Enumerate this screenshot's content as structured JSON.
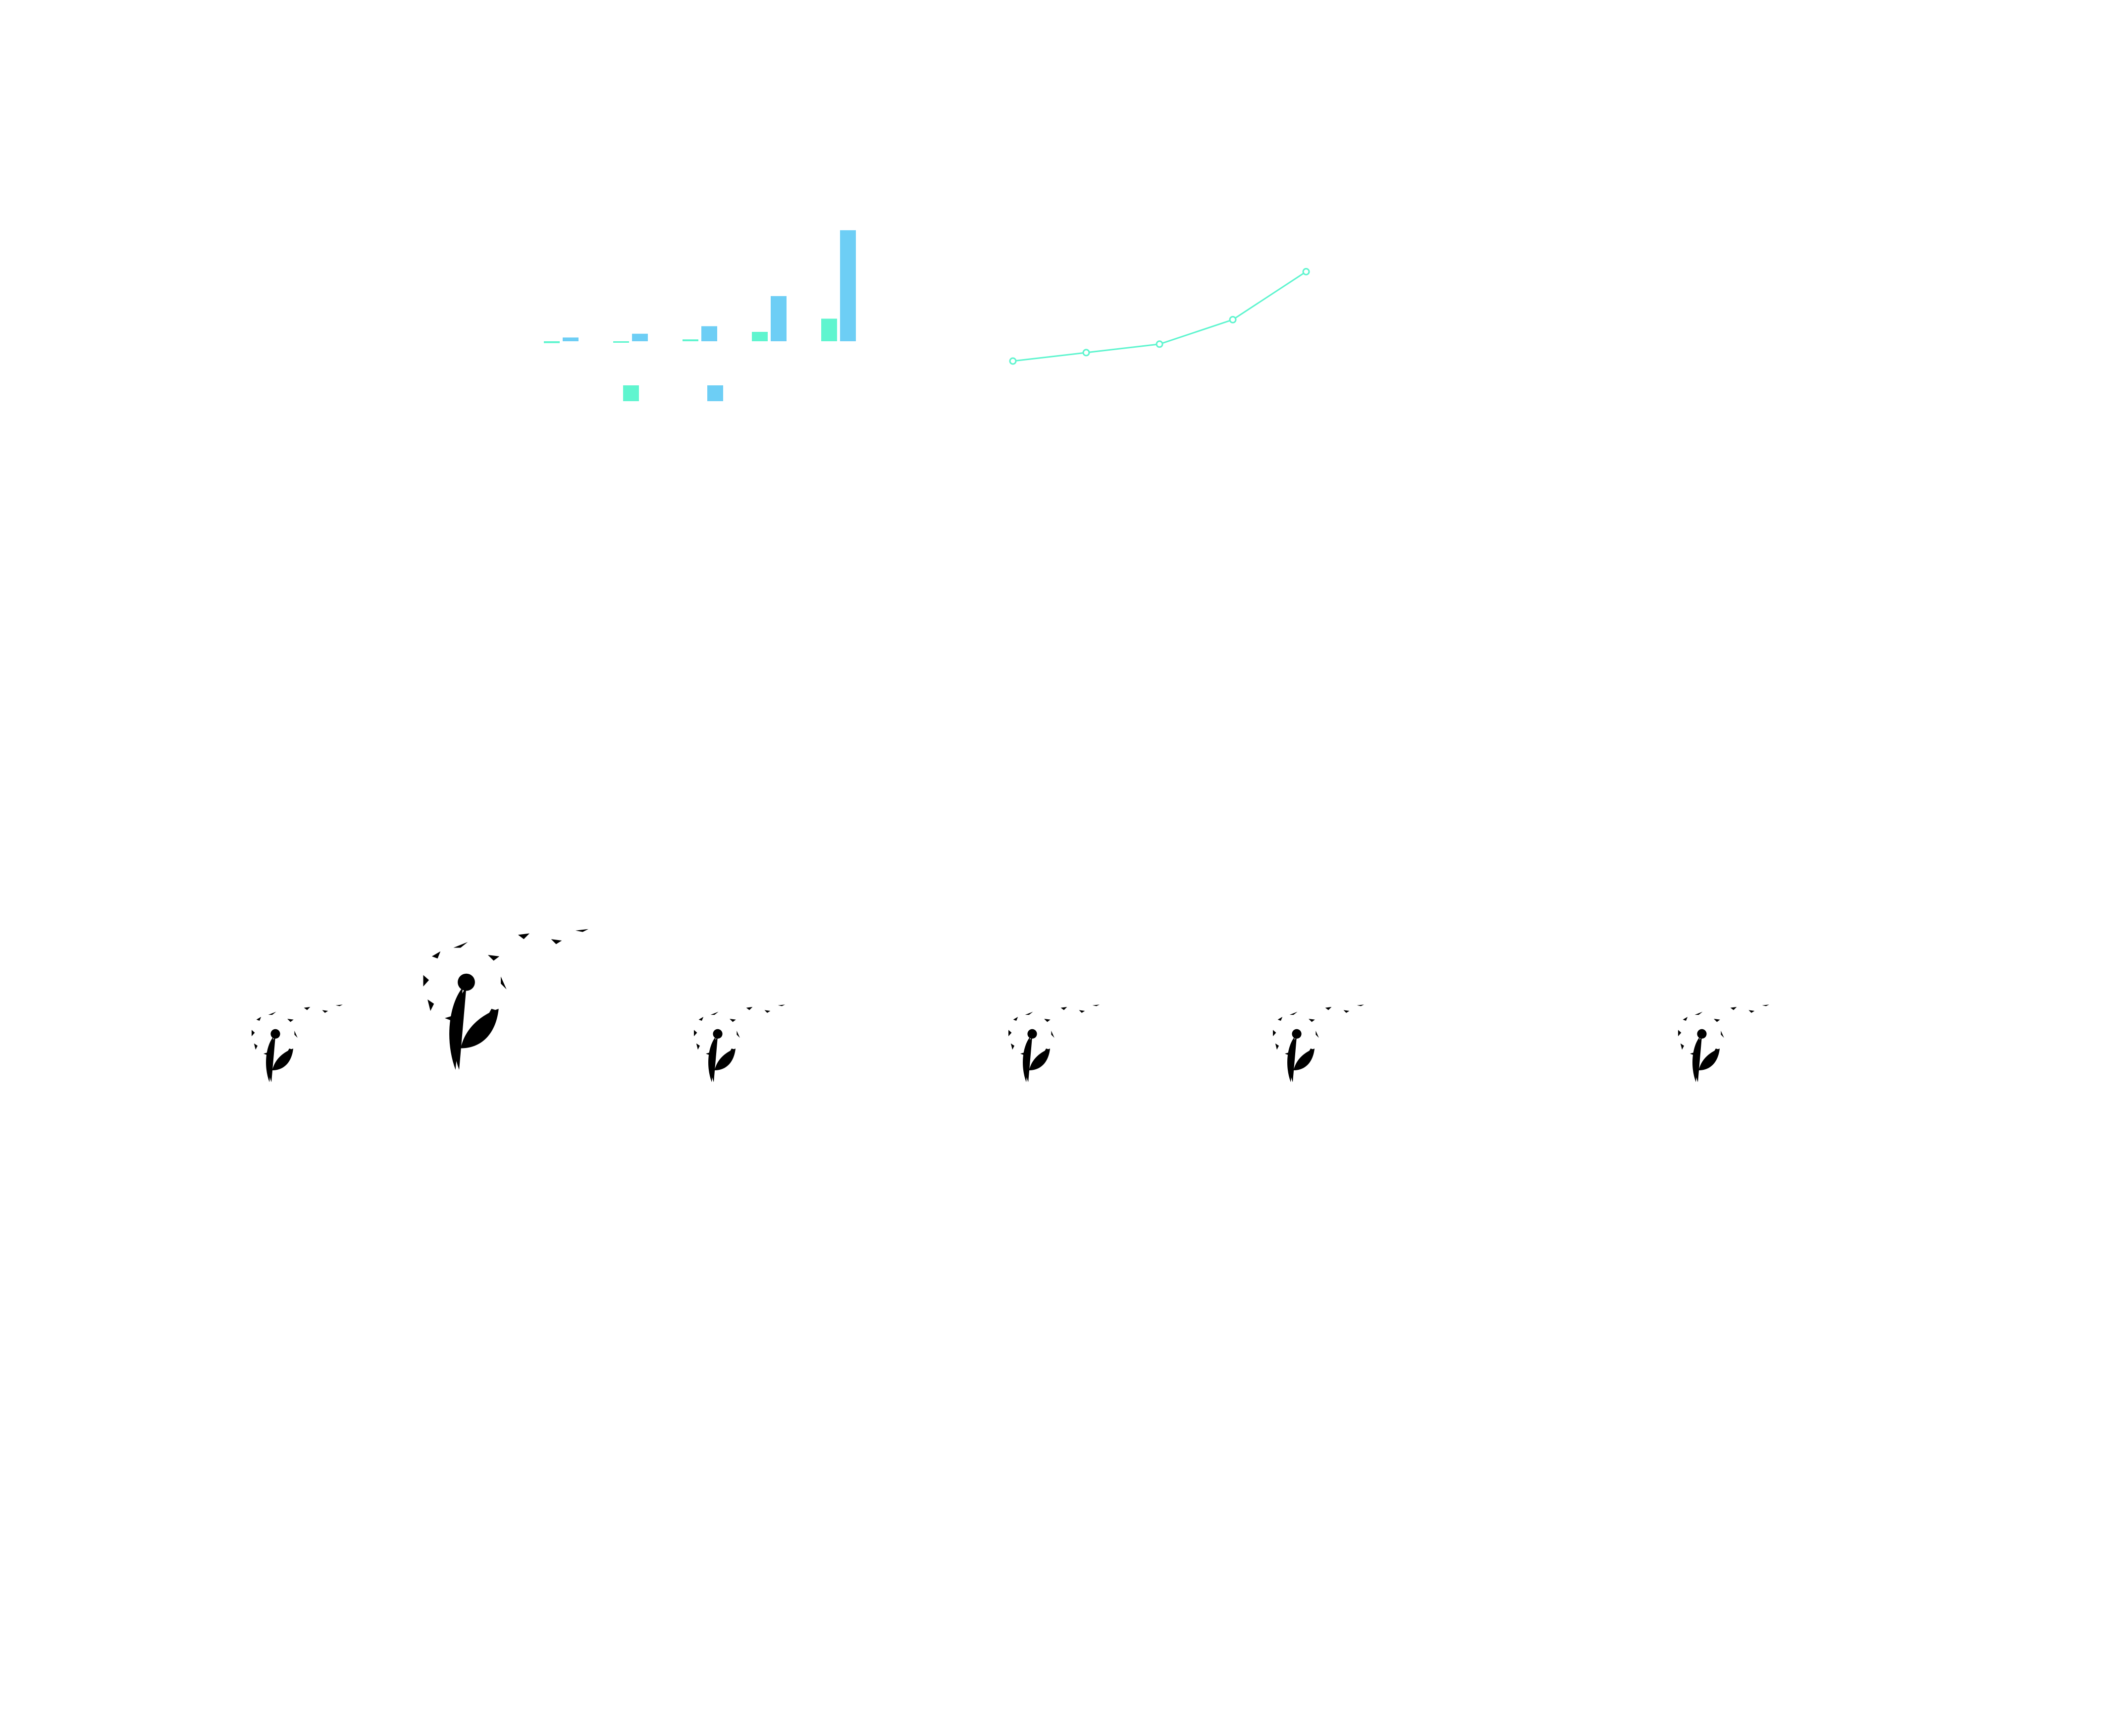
{
  "colors": {
    "background": "#ffffff",
    "series_teal": "#5ff5cf",
    "series_blue": "#6dcef5",
    "line": "#5ff5cf",
    "watermark": "#e0e0e0"
  },
  "chart_data": [
    {
      "type": "bar",
      "title": "",
      "xlabel": "",
      "ylabel": "",
      "categories": [
        "",
        "",
        "",
        "",
        ""
      ],
      "ylim": [
        -16,
        30
      ],
      "grid": false,
      "legend": "none",
      "series": [
        {
          "values": [
            -0.5,
            -0.2,
            0.5,
            2.5,
            6
          ]
        },
        {
          "values": [
            1,
            2,
            4,
            12,
            29.5
          ]
        }
      ],
      "legend_swatches": [
        "series_teal",
        "series_blue"
      ]
    },
    {
      "type": "line",
      "title": "",
      "xlabel": "",
      "ylabel": "",
      "x": [
        1,
        2,
        3,
        4,
        5
      ],
      "y": [
        0,
        0.9,
        1.8,
        4.4,
        9.5
      ],
      "ylim": [
        0,
        10
      ],
      "grid": false,
      "markers": "hollow-circle"
    }
  ],
  "watermarks": [
    {
      "icon": "dandelion-icon",
      "size": "small"
    },
    {
      "icon": "dandelion-icon",
      "size": "large"
    },
    {
      "icon": "dandelion-icon",
      "size": "small"
    },
    {
      "icon": "dandelion-icon",
      "size": "small"
    },
    {
      "icon": "dandelion-icon",
      "size": "small"
    },
    {
      "icon": "dandelion-icon",
      "size": "small"
    }
  ]
}
